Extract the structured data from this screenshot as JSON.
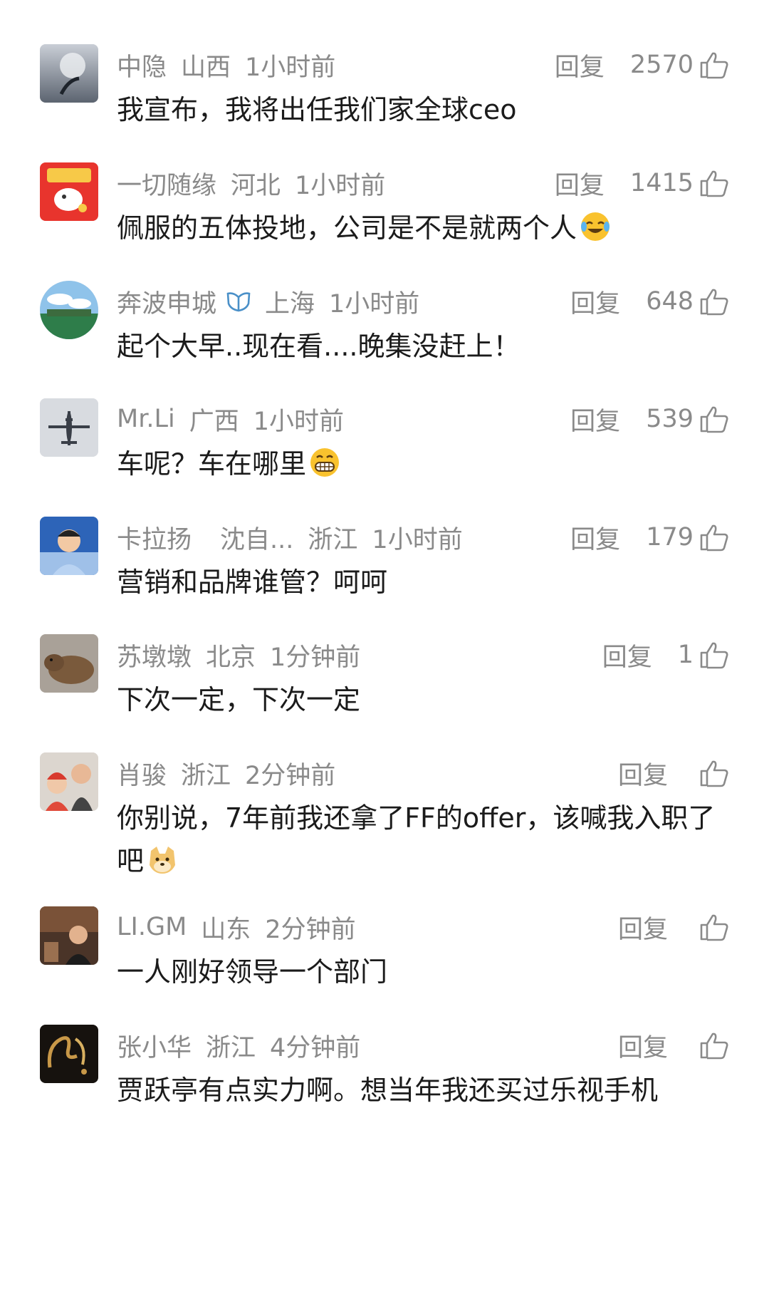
{
  "reply_label": "回复",
  "comments": [
    {
      "name": "中隐",
      "location": "山西",
      "time": "1小时前",
      "likes": "2570",
      "text": "我宣布，我将出任我们家全球ceo"
    },
    {
      "name": "一切随缘",
      "location": "河北",
      "time": "1小时前",
      "likes": "1415",
      "text": "佩服的五体投地，公司是不是就两个人",
      "emoji": "laugh-cry-emoji"
    },
    {
      "name": "奔波申城",
      "location": "上海",
      "time": "1小时前",
      "likes": "648",
      "text": "起个大早..现在看....晚集没赶上！",
      "verified": true
    },
    {
      "name": "Mr.Li",
      "location": "广西",
      "time": "1小时前",
      "likes": "539",
      "text": "车呢？车在哪里",
      "emoji": "grin-emoji"
    },
    {
      "name": "卡拉扬",
      "name_extra": "沈自...",
      "location": "浙江",
      "time": "1小时前",
      "likes": "179",
      "text": "营销和品牌谁管？呵呵"
    },
    {
      "name": "苏墩墩",
      "location": "北京",
      "time": "1分钟前",
      "likes": "1",
      "text": "下次一定，下次一定"
    },
    {
      "name": "肖骏",
      "location": "浙江",
      "time": "2分钟前",
      "likes": "",
      "text": "你别说，7年前我还拿了FF的offer，该喊我入职了吧",
      "emoji": "doge-emoji"
    },
    {
      "name": "LI.GM",
      "location": "山东",
      "time": "2分钟前",
      "likes": "",
      "text": "一人刚好领导一个部门"
    },
    {
      "name": "张小华",
      "location": "浙江",
      "time": "4分钟前",
      "likes": "",
      "text": "贾跃亭有点实力啊。想当年我还买过乐视手机"
    }
  ],
  "colors": {
    "meta": "#8a8a8a",
    "text": "#1b1b1b",
    "background": "#ffffff"
  }
}
